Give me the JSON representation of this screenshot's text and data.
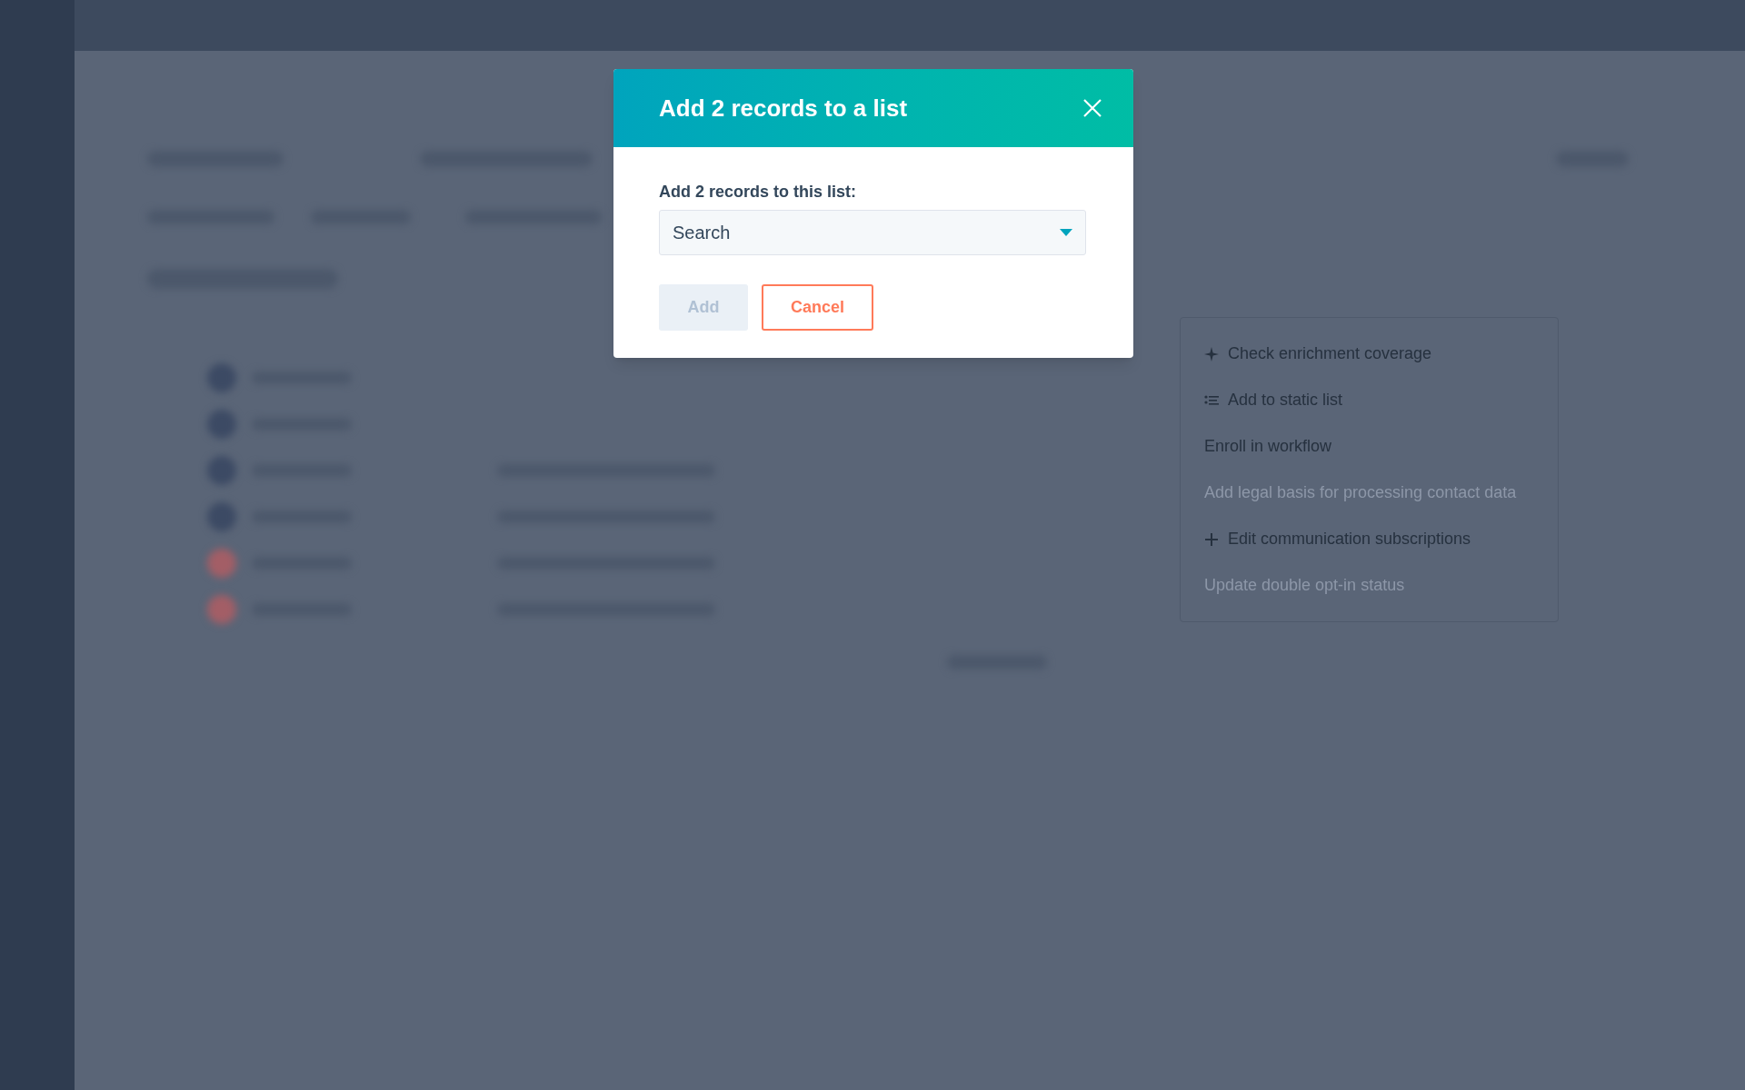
{
  "dialog": {
    "title": "Add 2 records to a list",
    "field_label": "Add 2 records to this list:",
    "select": {
      "placeholder": "Search"
    },
    "buttons": [
      {
        "label": "Add",
        "kind": "primary",
        "disabled": true
      },
      {
        "label": "Cancel",
        "kind": "secondary",
        "disabled": false
      }
    ]
  },
  "actions_menu": {
    "items": [
      {
        "label": "Check enrichment coverage",
        "kind": "sparkle",
        "disabled": false
      },
      {
        "label": "Add to static list",
        "kind": "list",
        "disabled": false
      },
      {
        "label": "Enroll in workflow",
        "kind": "plain",
        "disabled": false
      },
      {
        "label": "Add legal basis for processing contact data",
        "kind": "plain",
        "disabled": true
      },
      {
        "label": "Edit communication subscriptions",
        "kind": "plus",
        "disabled": false
      },
      {
        "label": "Update double opt-in status",
        "kind": "plain",
        "disabled": true
      }
    ]
  }
}
